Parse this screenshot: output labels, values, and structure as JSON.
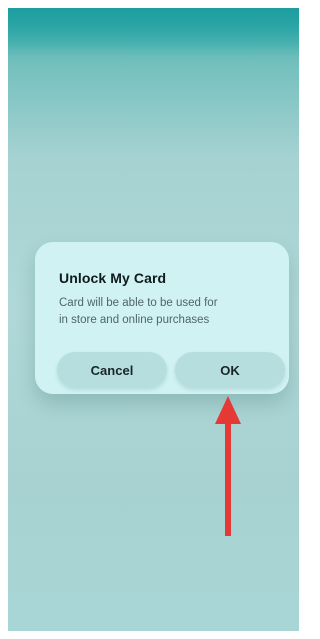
{
  "dialog": {
    "title": "Unlock My Card",
    "message_line1": "Card will be able to be used for",
    "message_line2": "in store and online purchases",
    "cancel_label": "Cancel",
    "ok_label": "OK"
  },
  "annotation": {
    "arrow_icon": "red-up-arrow-icon",
    "arrow_color": "#e53935"
  },
  "colors": {
    "background_teal": "#a6d2d2",
    "dialog_bg": "#d2f4f4",
    "button_bg": "#b7dede"
  }
}
